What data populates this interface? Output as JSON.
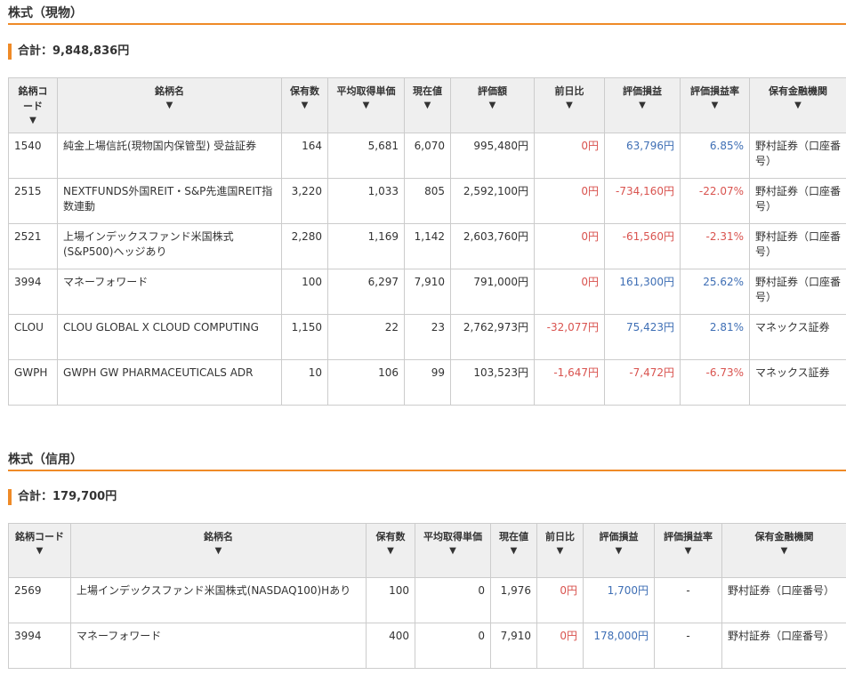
{
  "sort_arrow": "▼",
  "colors": {
    "accent": "#ef8a27",
    "negative": "#d9534f",
    "positive": "#3f6fb5",
    "header_bg": "#efefef"
  },
  "cash": {
    "title": "株式（現物）",
    "total": "合計：9,848,836円",
    "headers": [
      "銘柄コード",
      "銘柄名",
      "保有数",
      "平均取得単価",
      "現在値",
      "評価額",
      "前日比",
      "評価損益",
      "評価損益率",
      "保有金融機関"
    ],
    "rows": [
      {
        "code": "1540",
        "name": "純金上場信託(現物国内保管型) 受益証券",
        "qty": "164",
        "avg": "5,681",
        "price": "6,070",
        "value": "995,480円",
        "daychg": "0円",
        "pl": "63,796円",
        "plrate": "6.85%",
        "inst": "野村証券（口座番号）",
        "daychg_tone": "red",
        "pl_tone": "blue"
      },
      {
        "code": "2515",
        "name": "NEXTFUNDS外国REIT・S&P先進国REIT指数連動",
        "qty": "3,220",
        "avg": "1,033",
        "price": "805",
        "value": "2,592,100円",
        "daychg": "0円",
        "pl": "-734,160円",
        "plrate": "-22.07%",
        "inst": "野村証券（口座番号）",
        "daychg_tone": "red",
        "pl_tone": "red"
      },
      {
        "code": "2521",
        "name": "上場インデックスファンド米国株式(S&P500)ヘッジあり",
        "qty": "2,280",
        "avg": "1,169",
        "price": "1,142",
        "value": "2,603,760円",
        "daychg": "0円",
        "pl": "-61,560円",
        "plrate": "-2.31%",
        "inst": "野村証券（口座番号）",
        "daychg_tone": "red",
        "pl_tone": "red"
      },
      {
        "code": "3994",
        "name": "マネーフォワード",
        "qty": "100",
        "avg": "6,297",
        "price": "7,910",
        "value": "791,000円",
        "daychg": "0円",
        "pl": "161,300円",
        "plrate": "25.62%",
        "inst": "野村証券（口座番号）",
        "daychg_tone": "red",
        "pl_tone": "blue"
      },
      {
        "code": "CLOU",
        "name": "CLOU GLOBAL X CLOUD COMPUTING",
        "qty": "1,150",
        "avg": "22",
        "price": "23",
        "value": "2,762,973円",
        "daychg": "-32,077円",
        "pl": "75,423円",
        "plrate": "2.81%",
        "inst": "マネックス証券",
        "daychg_tone": "red",
        "pl_tone": "blue"
      },
      {
        "code": "GWPH",
        "name": "GWPH GW PHARMACEUTICALS ADR",
        "qty": "10",
        "avg": "106",
        "price": "99",
        "value": "103,523円",
        "daychg": "-1,647円",
        "pl": "-7,472円",
        "plrate": "-6.73%",
        "inst": "マネックス証券",
        "daychg_tone": "red",
        "pl_tone": "red"
      }
    ]
  },
  "margin": {
    "title": "株式（信用）",
    "total": "合計：179,700円",
    "headers": [
      "銘柄コード",
      "銘柄名",
      "保有数",
      "平均取得単価",
      "現在値",
      "前日比",
      "評価損益",
      "評価損益率",
      "保有金融機関"
    ],
    "rows": [
      {
        "code": "2569",
        "name": "上場インデックスファンド米国株式(NASDAQ100)Hあり",
        "qty": "100",
        "avg": "0",
        "price": "1,976",
        "daychg": "0円",
        "pl": "1,700円",
        "plrate": "-",
        "inst": "野村証券（口座番号）",
        "daychg_tone": "red",
        "pl_tone": "blue"
      },
      {
        "code": "3994",
        "name": "マネーフォワード",
        "qty": "400",
        "avg": "0",
        "price": "7,910",
        "daychg": "0円",
        "pl": "178,000円",
        "plrate": "-",
        "inst": "野村証券（口座番号）",
        "daychg_tone": "red",
        "pl_tone": "blue"
      }
    ]
  }
}
